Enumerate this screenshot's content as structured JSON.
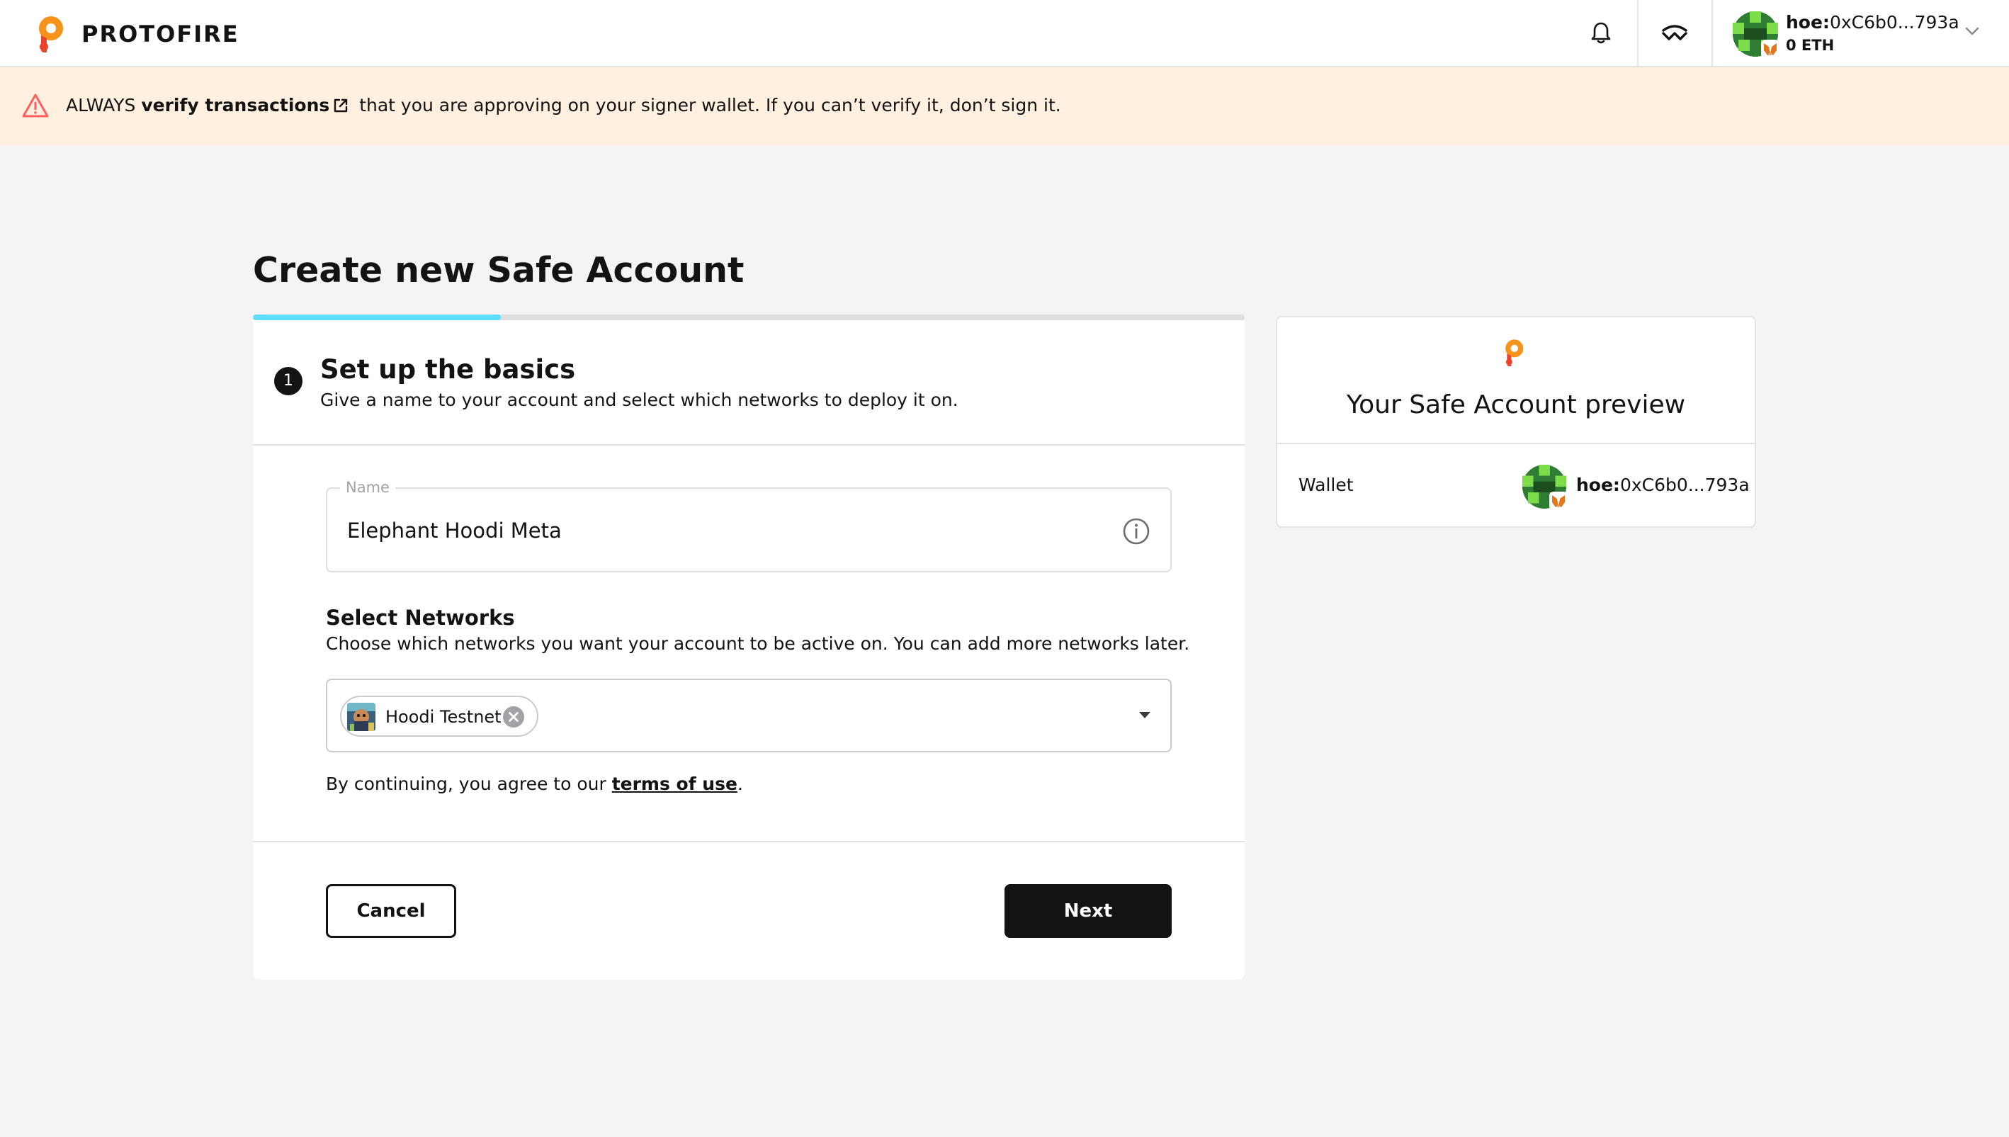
{
  "header": {
    "brand": "PROTOFIRE",
    "account": {
      "prefix": "hoe:",
      "address": "0xC6b0...793a",
      "balance": "0 ETH"
    }
  },
  "banner": {
    "lead": "ALWAYS ",
    "link": "verify transactions",
    "rest": " that you are approving on your signer wallet. If you can’t verify it, don’t sign it."
  },
  "page": {
    "title": "Create new Safe Account",
    "progress_percent": 25
  },
  "step": {
    "number": "1",
    "title": "Set up the basics",
    "subtitle": "Give a name to your account and select which networks to deploy it on."
  },
  "form": {
    "name_label": "Name",
    "name_value": "Elephant Hoodi Meta",
    "networks_title": "Select Networks",
    "networks_subtitle": "Choose which networks you want your account to be active on. You can add more networks later.",
    "selected_network": "Hoodi Testnet",
    "terms_prefix": "By continuing, you agree to our ",
    "terms_link": "terms of use",
    "terms_suffix": ".",
    "cancel_label": "Cancel",
    "next_label": "Next"
  },
  "preview": {
    "title": "Your Safe Account preview",
    "wallet_label": "Wallet",
    "wallet_prefix": "hoe:",
    "wallet_address": "0xC6b0...793a"
  },
  "colors": {
    "accent": "#5fddff",
    "brand_orange": "#f7931a",
    "warning_bg": "#fff0e0",
    "warning_icon": "#ff5f5f",
    "dark": "#121312"
  },
  "icons": [
    "protofire-logo",
    "bell-icon",
    "walletconnect-icon",
    "avatar",
    "metamask-icon",
    "chevron-down-icon",
    "warning-icon",
    "external-link-icon",
    "info-icon",
    "close-circle-icon",
    "caret-down-icon"
  ]
}
